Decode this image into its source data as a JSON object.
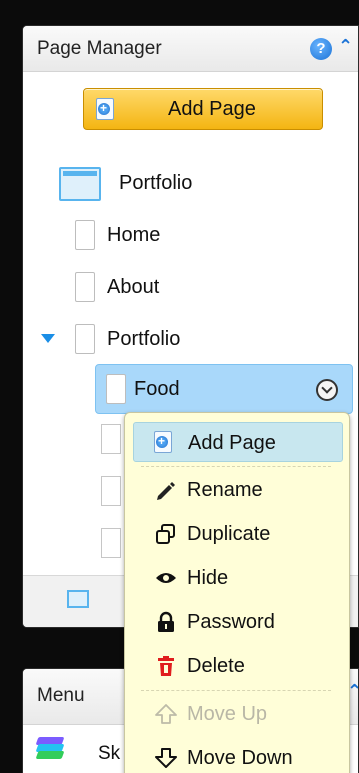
{
  "page_manager": {
    "title": "Page Manager",
    "help_icon": "?",
    "add_page_label": "Add Page",
    "tree": {
      "site": "Portfolio",
      "pages": [
        "Home",
        "About",
        "Portfolio"
      ],
      "selected": "Food"
    }
  },
  "context_menu": {
    "items": [
      {
        "label": "Add Page",
        "icon": "add-page-icon"
      },
      {
        "label": "Rename",
        "icon": "pencil-icon"
      },
      {
        "label": "Duplicate",
        "icon": "duplicate-icon"
      },
      {
        "label": "Hide",
        "icon": "eye-icon"
      },
      {
        "label": "Password",
        "icon": "lock-icon"
      },
      {
        "label": "Delete",
        "icon": "trash-icon"
      },
      {
        "label": "Move Up",
        "icon": "arrow-up-icon"
      },
      {
        "label": "Move Down",
        "icon": "arrow-down-icon"
      }
    ]
  },
  "menu_panel": {
    "title": "Menu",
    "item_partial": "Sk"
  },
  "colors": {
    "accent_blue": "#1a8ee6",
    "selection": "#a9d8fa",
    "button_yellow": "#f4b512",
    "context_bg": "#fffed8",
    "delete_red": "#e01d1d"
  }
}
